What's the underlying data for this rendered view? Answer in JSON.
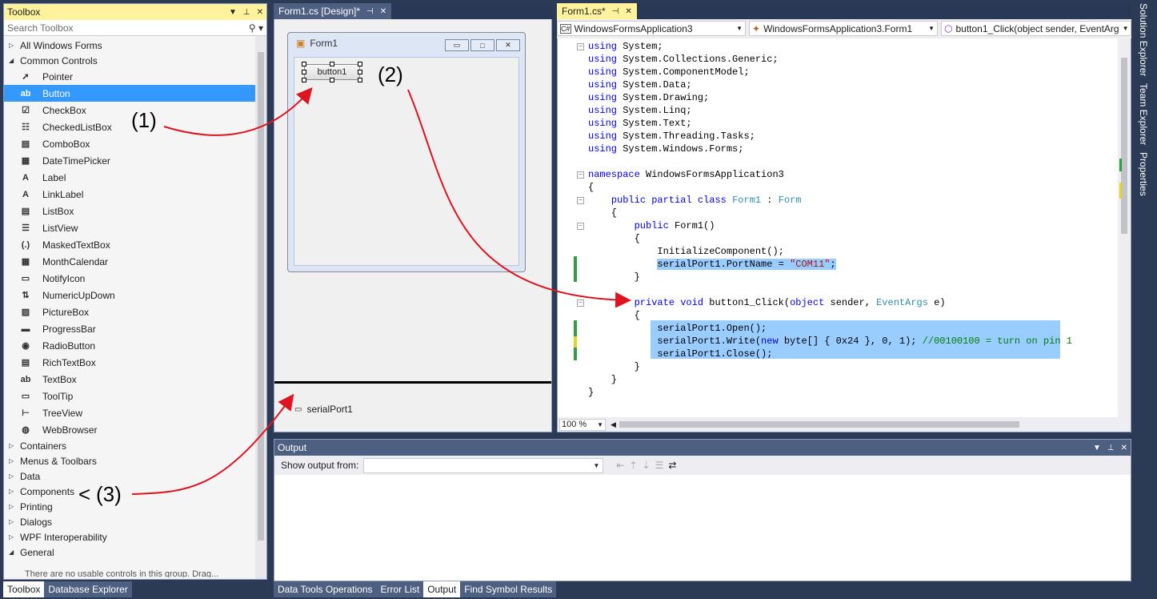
{
  "toolbox": {
    "title": "Toolbox",
    "search_placeholder": "Search Toolbox",
    "all_group": "All Windows Forms",
    "common_group": "Common Controls",
    "items": [
      "Pointer",
      "Button",
      "CheckBox",
      "CheckedListBox",
      "ComboBox",
      "DateTimePicker",
      "Label",
      "LinkLabel",
      "ListBox",
      "ListView",
      "MaskedTextBox",
      "MonthCalendar",
      "NotifyIcon",
      "NumericUpDown",
      "PictureBox",
      "ProgressBar",
      "RadioButton",
      "RichTextBox",
      "TextBox",
      "ToolTip",
      "TreeView",
      "WebBrowser"
    ],
    "selected_item": "Button",
    "groups_after": [
      "Containers",
      "Menus & Toolbars",
      "Data",
      "Components",
      "Printing",
      "Dialogs",
      "WPF Interoperability"
    ],
    "general_group": "General",
    "general_hint": "There are no usable controls in this group. Drag..."
  },
  "bottom_tabs": {
    "toolbox": "Toolbox",
    "database_explorer": "Database Explorer"
  },
  "designer": {
    "tab": "Form1.cs [Design]*",
    "form_title": "Form1",
    "button_text": "button1",
    "tray_component": "serialPort1"
  },
  "editor": {
    "tab": "Form1.cs*",
    "nav_project": "WindowsFormsApplication3",
    "nav_class": "WindowsFormsApplication3.Form1",
    "nav_member": "button1_Click(object sender, EventArg",
    "zoom": "100 %",
    "lines": {
      "u1": "System;",
      "u2": "System.Collections.Generic;",
      "u3": "System.ComponentModel;",
      "u4": "System.Data;",
      "u5": "System.Drawing;",
      "u6": "System.Linq;",
      "u7": "System.Text;",
      "u8": "System.Threading.Tasks;",
      "u9": "System.Windows.Forms;",
      "ns": "WindowsFormsApplication3",
      "cls": "Form1",
      "base": "Form",
      "ctor": "Form1()",
      "init": "InitializeComponent();",
      "port_a": "serialPort1.PortName = ",
      "port_b": "\"COM11\"",
      "method": "button1_Click(",
      "evtargs": "EventArgs",
      "open": "serialPort1.Open();",
      "write_a": "serialPort1.Write(",
      "write_b": "byte[] { 0x24 }, 0, 1); ",
      "write_c": "//00100100 = turn on pin 1",
      "close": "serialPort1.Close();"
    },
    "kw": {
      "using": "using",
      "namespace": "namespace",
      "public": "public",
      "partial": "partial",
      "class": "class",
      "private": "private",
      "void": "void",
      "object": "object",
      "new": "new"
    }
  },
  "output": {
    "title": "Output",
    "show_from_label": "Show output from:"
  },
  "output_tabs": [
    "Data Tools Operations",
    "Error List",
    "Output",
    "Find Symbol Results"
  ],
  "right_rail": [
    "Solution Explorer",
    "Team Explorer",
    "Properties"
  ],
  "annotations": {
    "a1": "(1)",
    "a2": "(2)",
    "a3": "(3)",
    "a3_prefix": "<"
  },
  "colors": {
    "accent_tab": "#fff29d",
    "selection": "#3399ff",
    "highlight": "#99ccff",
    "arrow": "#e0141e"
  }
}
